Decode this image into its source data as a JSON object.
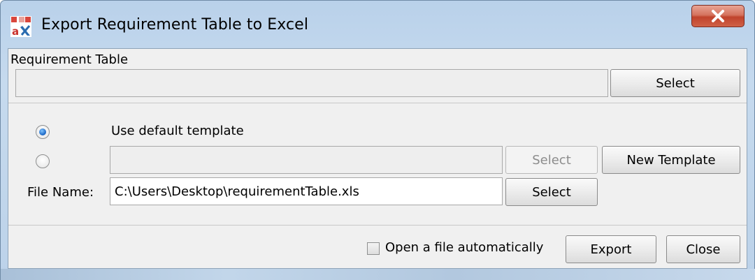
{
  "window": {
    "title": "Export Requirement Table to Excel",
    "icon": "app-an-icon",
    "close_icon": "close-x-icon"
  },
  "requirement_table": {
    "label": "Requirement Table",
    "value": "",
    "select_label": "Select"
  },
  "template": {
    "default_option_label": "Use default template",
    "default_selected": true,
    "custom_selected": false,
    "custom_path_value": "",
    "custom_select_label": "Select",
    "new_template_label": "New Template"
  },
  "file": {
    "label": "File Name:",
    "value": "C:\\Users\\Desktop\\requirementTable.xls",
    "select_label": "Select"
  },
  "footer": {
    "open_auto_label": "Open a file automatically",
    "open_auto_checked": false,
    "export_label": "Export",
    "close_label": "Close"
  },
  "colors": {
    "accent": "#1763c2",
    "close_button": "#c0432c",
    "titlebar": "#b9d1ea"
  }
}
